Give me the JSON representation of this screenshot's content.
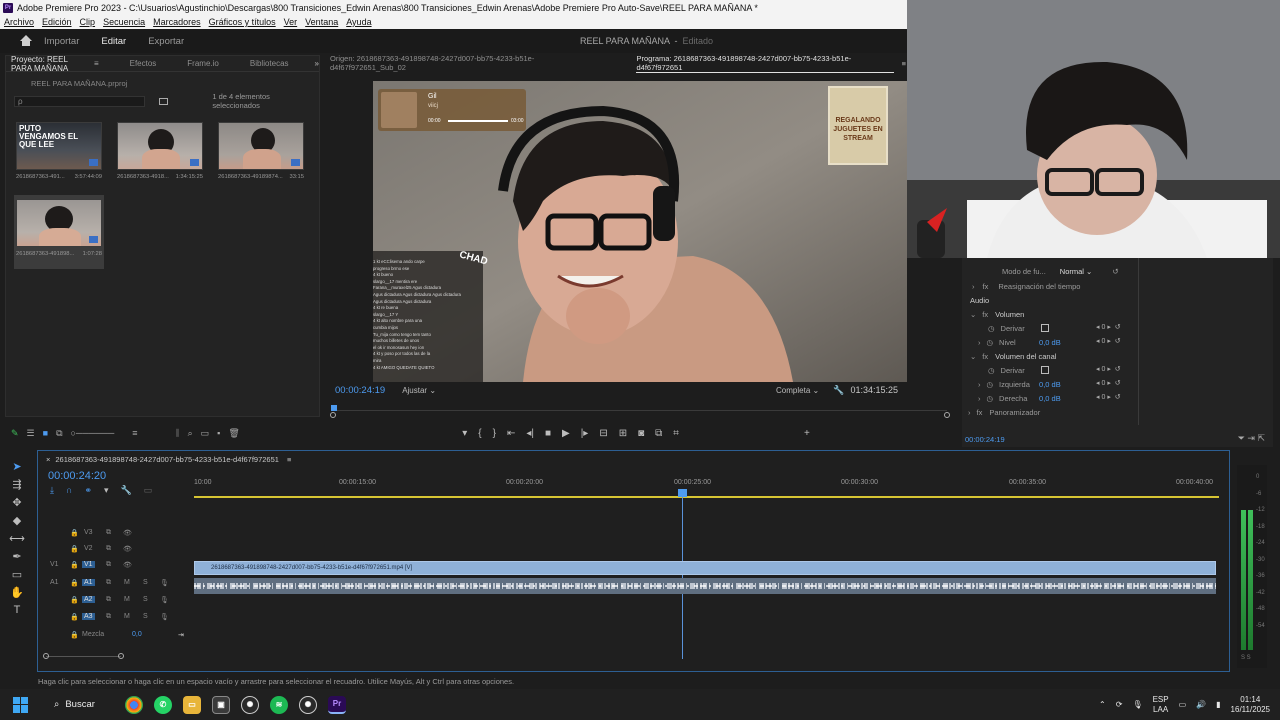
{
  "window": {
    "title": "Adobe Premiere Pro 2023 - C:\\Usuarios\\Agustinchio\\Descargas\\800 Transiciones_Edwin Arenas\\800 Transiciones_Edwin Arenas\\Adobe Premiere Pro Auto-Save\\REEL PARA MAÑANA *",
    "app_icon": "Pr"
  },
  "menu": [
    "Archivo",
    "Edición",
    "Clip",
    "Secuencia",
    "Marcadores",
    "Gráficos y títulos",
    "Ver",
    "Ventana",
    "Ayuda"
  ],
  "workspace": {
    "tabs": [
      "Importar",
      "Editar",
      "Exportar"
    ],
    "active": "Editar",
    "project_title": "REEL PARA MAÑANA",
    "project_state": "Editado"
  },
  "project_panel": {
    "tabs": [
      "Proyecto: REEL PARA MAÑANA",
      "Efectos",
      "Frame.io",
      "Bibliotecas"
    ],
    "file": "REEL PARA MAÑANA.prproj",
    "search_placeholder": "ρ",
    "selection": "1 de 4 elementos seleccionados",
    "items": [
      {
        "name": "2618687363-491...",
        "duration": "3:57:44:09",
        "overlay": "PUTO VENGAMOS EL QUE LEE"
      },
      {
        "name": "2618687363-4918...",
        "duration": "1:34:15:25",
        "overlay": ""
      },
      {
        "name": "2618687363-49189874...",
        "duration": "33:15",
        "overlay": ""
      },
      {
        "name": "2618687363-491898...",
        "duration": "1:07:28",
        "overlay": ""
      }
    ]
  },
  "program_monitor": {
    "source_tab": "Origen: 2618687363-491898748-2427d007-bb75-4233-b51e-d4f67f972651_Sub_02",
    "program_tab": "Programa: 2618687363-491898748-2427d007-bb75-4233-b51e-d4f67f972651",
    "current_time": "00:00:24:19",
    "fit": "Ajustar",
    "quality": "Completa",
    "duration": "01:34:15:25",
    "overlay": {
      "music_title": "Gil",
      "music_artist": "viicj",
      "music_time_start": "00:00",
      "music_time_end": "03:00",
      "badge_text": "REGALANDO JUGUETES EN STREAM",
      "chad_label": "CHAD",
      "chat_lines": [
        "1 kt  eCClisema ando carpe",
        "progreso brrno ese",
        "4 kt  bueno",
        "slargo__17  mentira ere",
        "Farana__muraxel25  Agus dictadura",
        "Agus dictadura Agus dictadura Agus dictadura",
        "Agus dictadura Agus dictadura",
        "4 kt  re buena",
        "slargo__17  Y",
        "4 kt  alto nombre para una",
        "cumbia mijos",
        "Tu_mija  como tengo tem tanto",
        "muchos billetes de unos",
        "el ok ir monosasun hey ion",
        "4 kt  y poso por todos las de la",
        "mira",
        "4 kt  AMIGO QUEDATE QUIETO"
      ]
    }
  },
  "effect_controls": {
    "blend_mode_label": "Modo de fu...",
    "blend_mode_value": "Normal",
    "time_remap": "Reasignación del tiempo",
    "audio_label": "Audio",
    "volume_label": "Volumen",
    "bypass_label": "Derivar",
    "level_label": "Nivel",
    "level_value": "0,0 dB",
    "channel_volume_label": "Volumen del canal",
    "left_label": "Izquierda",
    "left_value": "0,0 dB",
    "right_label": "Derecha",
    "right_value": "0,0 dB",
    "panner_label": "Panoramizador",
    "time": "00:00:24:19",
    "zero": "0"
  },
  "timeline": {
    "sequence": "2618687363-491898748-2427d007-bb75-4233-b51e-d4f67f972651",
    "timecode": "00:00:24:20",
    "ruler": [
      "10:00",
      "00:00:15:00",
      "00:00:20:00",
      "00:00:25:00",
      "00:00:30:00",
      "00:00:35:00",
      "00:00:40:00"
    ],
    "tracks": {
      "video": [
        "V3",
        "V2",
        "V1"
      ],
      "audio": [
        "A1",
        "A2",
        "A3"
      ],
      "mix_label": "Mezcla",
      "mix_value": "0,0"
    },
    "clip_label": "2618687363-491898748-2427d007-bb75-4233-b51e-d4f67f972651.mp4 [V]",
    "playhead_fraction": 0.475
  },
  "meter_scale": [
    "0",
    "-6",
    "-12",
    "-18",
    "-24",
    "-30",
    "-36",
    "-42",
    "-48",
    "-54"
  ],
  "meter_footer": "S S",
  "status": "Haga clic para seleccionar o haga clic en un espacio vacío y arrastre para seleccionar el recuadro. Utilice Mayús, Alt y Ctrl para otras opciones.",
  "taskbar": {
    "search": "Buscar",
    "lang_top": "ESP",
    "lang_bottom": "LAA",
    "time": "01:14",
    "date": "16/11/2025"
  },
  "colors": {
    "accent": "#4d9bf0",
    "timeline_border": "#2d5f93",
    "work_area_bar": "#d6c433",
    "video_clip": "#8fb1d8"
  }
}
